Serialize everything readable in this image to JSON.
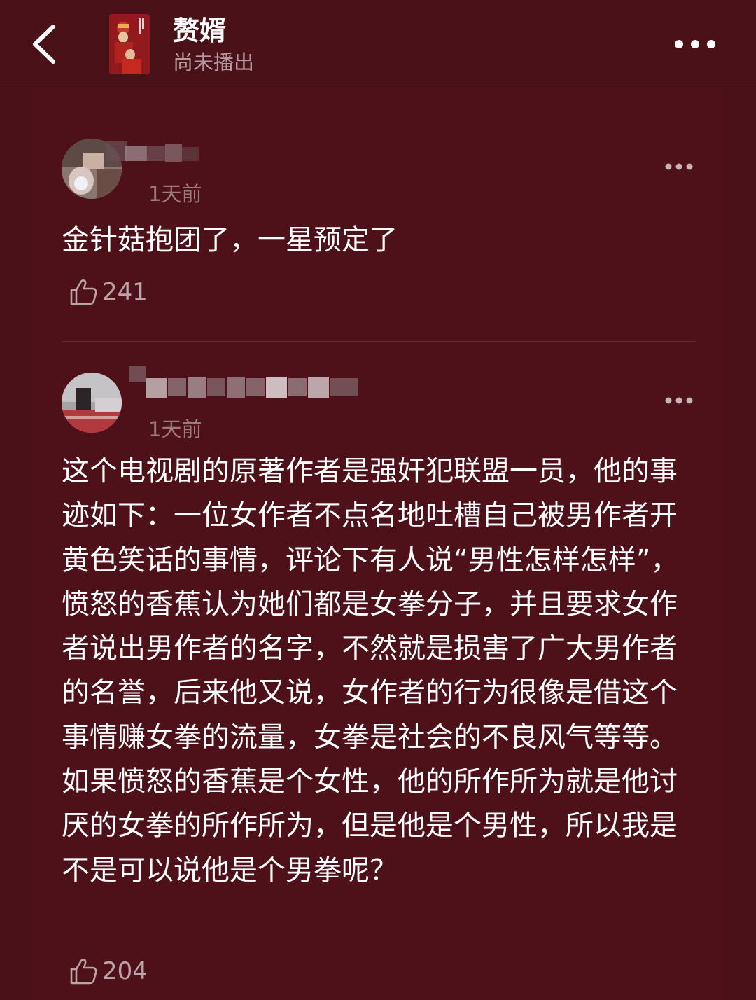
{
  "header": {
    "back_icon": "chevron-left-icon",
    "title": "赘婿",
    "status": "尚未播出",
    "more_icon": "more-horizontal-icon"
  },
  "comments": [
    {
      "time": "1天前",
      "text": "金针菇抱团了，一星预定了",
      "likes": "241"
    },
    {
      "time": "1天前",
      "text": "这个电视剧的原著作者是强奸犯联盟一员，他的事迹如下：一位女作者不点名地吐槽自己被男作者开黄色笑话的事情，评论下有人说“男性怎样怎样”，愤怒的香蕉认为她们都是女拳分子，并且要求女作者说出男作者的名字，不然就是损害了广大男作者的名誉，后来他又说，女作者的行为很像是借这个事情赚女拳的流量，女拳是社会的不良风气等等。如果愤怒的香蕉是个女性，他的所作所为就是他讨厌的女拳的所作所为，但是他是个男性，所以我是不是可以说他是个男拳呢？",
      "likes": "204"
    }
  ],
  "colors": {
    "background": "#4a1119",
    "panel": "#4e111a",
    "secondary_text": "#9b7b80"
  }
}
